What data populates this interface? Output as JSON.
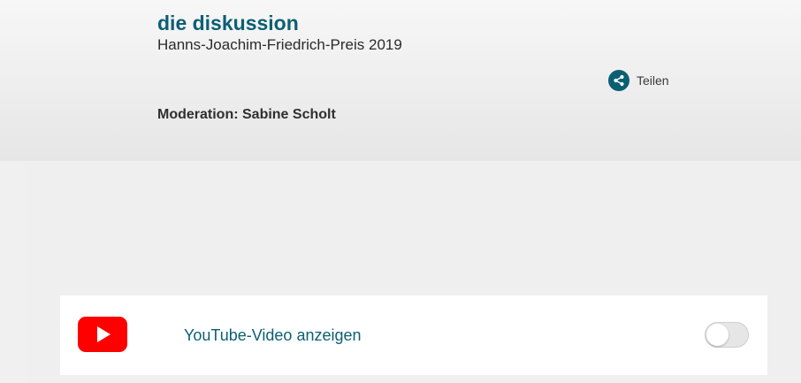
{
  "header": {
    "title": "die diskussion",
    "subtitle": "Hanns-Joachim-Friedrich-Preis 2019",
    "share_label": "Teilen",
    "moderation": "Moderation: Sabine Scholt"
  },
  "consent": {
    "label": "YouTube-Video anzeigen",
    "toggle_on": false
  },
  "icons": {
    "share": "share-icon",
    "youtube": "youtube-logo-icon"
  },
  "colors": {
    "accent": "#0c5f73",
    "youtube_red": "#ff0000",
    "header_bg_top": "#f7f7f7",
    "header_bg_bottom": "#e6e6e6"
  }
}
